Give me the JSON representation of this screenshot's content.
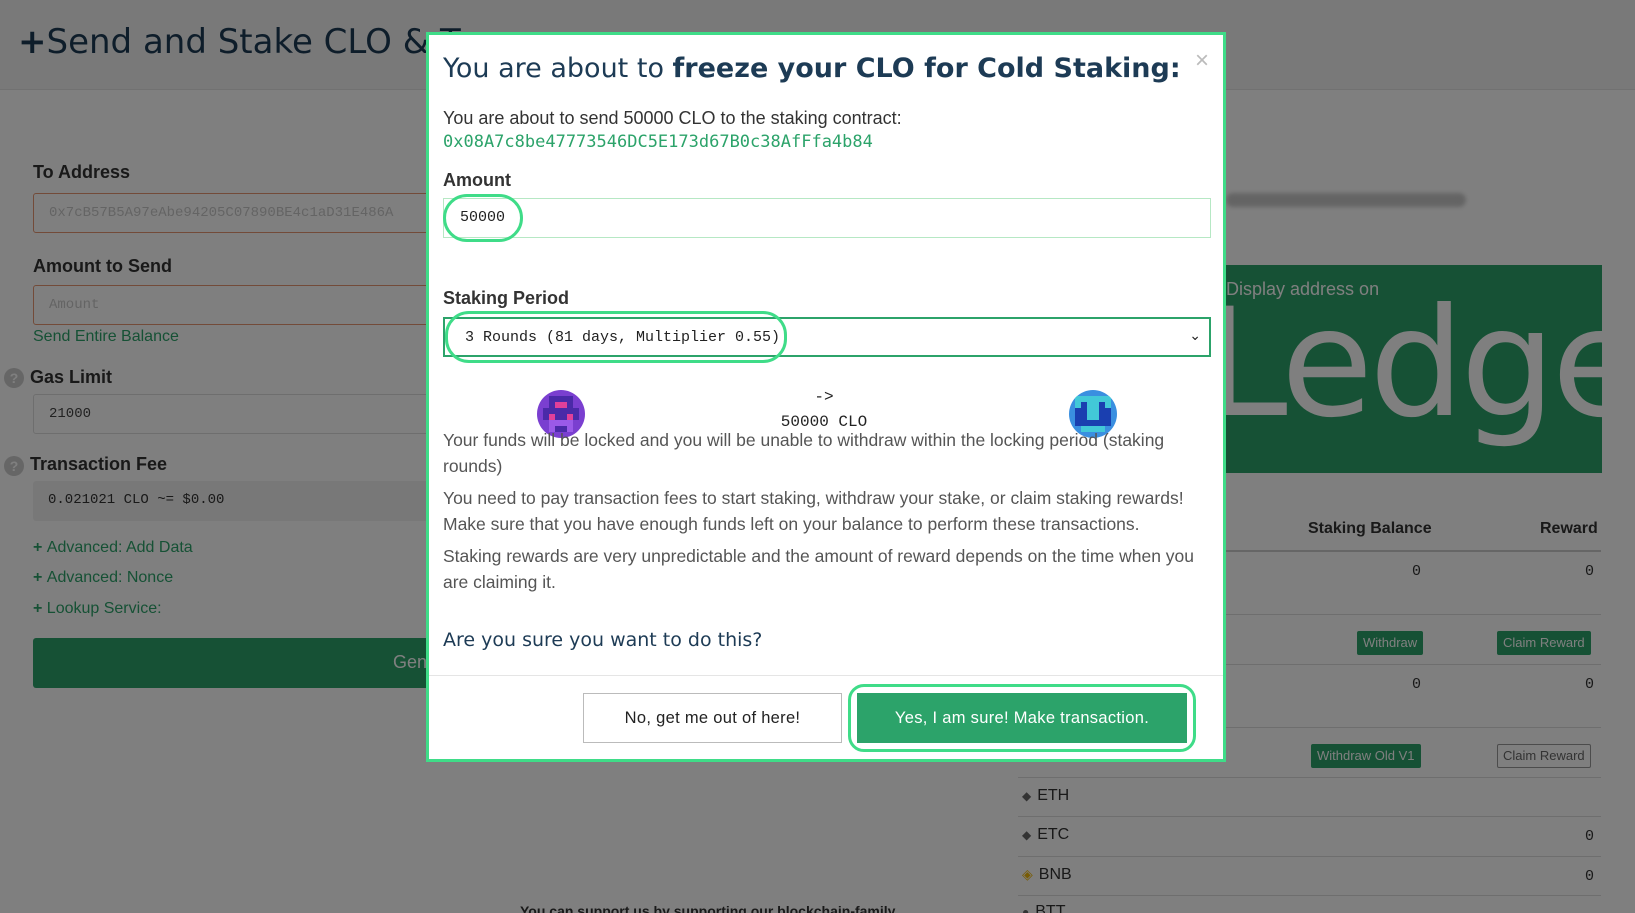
{
  "background": {
    "page_title": "Send and Stake CLO & T",
    "to_address": {
      "label": "To Address",
      "value": "0x7cB57B5A97eAbe94205C07890BE4c1aD31E486A"
    },
    "amount_to_send": {
      "label": "Amount to Send",
      "placeholder": "Amount",
      "send_entire_balance": "Send Entire Balance"
    },
    "gas_limit": {
      "label": "Gas Limit",
      "value": "21000"
    },
    "transaction_fee": {
      "label": "Transaction Fee",
      "value": "0.021021 CLO ~= $0.00"
    },
    "advanced": {
      "add_data": "Advanced: Add Data",
      "nonce": "Advanced: Nonce",
      "lookup": "Lookup Service:"
    },
    "generate_button": "Gen",
    "ledger": {
      "caption": "Display address on",
      "word": "Ledger"
    },
    "table": {
      "col_staking_balance": "Staking Balance",
      "col_reward": "Reward",
      "row1": {
        "balance": "0",
        "reward": "0"
      },
      "withdraw": "Withdraw",
      "claim_reward": "Claim Reward",
      "row2": {
        "balance": "0",
        "reward": "0"
      },
      "withdraw_old_v1": "Withdraw Old V1",
      "claim_reward_2": "Claim Reward"
    },
    "tokens": [
      {
        "symbol": "ETH",
        "value": ""
      },
      {
        "symbol": "ETC",
        "value": "0"
      },
      {
        "symbol": "BNB",
        "value": "0"
      },
      {
        "symbol": "BTT",
        "value": ""
      }
    ],
    "bottom_text": "You can support us by supporting our blockchain-family"
  },
  "modal": {
    "title_prefix": "You are about to ",
    "title_bold": "freeze your CLO for Cold Staking:",
    "close": "×",
    "send_text": "You are about to send 50000 CLO to the staking contract:",
    "contract_address": "0x08A7c8be47773546DC5E173d67B0c38AfFfa4b84",
    "amount_label": "Amount",
    "amount_value": "50000",
    "staking_period_label": "Staking Period",
    "staking_period_value": "3 Rounds (81 days, Multiplier 0.55)",
    "arrow": "->",
    "arrow_amount": "50000 CLO",
    "para1": "Your funds will be locked and you will be unable to withdraw within the locking period (staking rounds)",
    "para2": "You need to pay transaction fees to start staking, withdraw your stake, or claim staking rewards! Make sure that you have enough funds left on your balance to perform these transactions.",
    "para3": "Staking rewards are very unpredictable and the amount of reward depends on the time when you are claiming it.",
    "question": "Are you sure you want to do this?",
    "btn_no": "No, get me out of here!",
    "btn_yes": "Yes, I am sure! Make transaction."
  }
}
